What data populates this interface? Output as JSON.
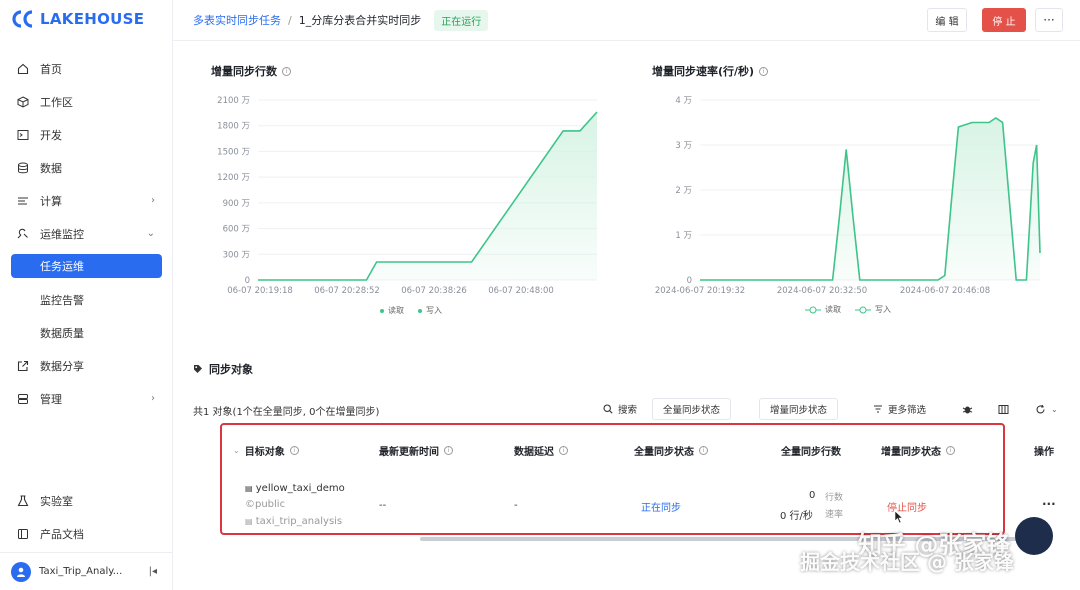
{
  "brand": {
    "name": "LAKEHOUSE"
  },
  "sidebar": {
    "items": [
      {
        "label": "首页",
        "icon": "home-icon"
      },
      {
        "label": "工作区",
        "icon": "cube-icon"
      },
      {
        "label": "开发",
        "icon": "terminal-icon"
      },
      {
        "label": "数据",
        "icon": "database-icon"
      },
      {
        "label": "计算",
        "icon": "compute-icon",
        "expandable": true
      },
      {
        "label": "运维监控",
        "icon": "monitor-icon",
        "expanded": true
      }
    ],
    "sub_items": [
      {
        "label": "任务运维",
        "active": true
      },
      {
        "label": "监控告警"
      },
      {
        "label": "数据质量"
      }
    ],
    "items2": [
      {
        "label": "数据分享",
        "icon": "share-icon"
      },
      {
        "label": "管理",
        "icon": "manage-icon",
        "expandable": true
      }
    ],
    "bottom": [
      {
        "label": "实验室",
        "icon": "flask-icon"
      },
      {
        "label": "产品文档",
        "icon": "book-icon"
      }
    ],
    "footer": {
      "workspace": "Taxi_Trip_Analy..."
    }
  },
  "header": {
    "breadcrumb_parent": "多表实时同步任务",
    "breadcrumb_sep": "/",
    "breadcrumb_current": "1_分库分表合并实时同步",
    "status": "正在运行",
    "edit_label": "编 辑",
    "stop_label": "停 止",
    "more_label": "···"
  },
  "charts": {
    "rows": {
      "title": "增量同步行数",
      "legend": [
        "读取",
        "写入"
      ]
    },
    "rate": {
      "title": "增量同步速率(行/秒)",
      "legend": [
        "读取",
        "写入"
      ]
    }
  },
  "chart_data": [
    {
      "type": "area",
      "title": "增量同步行数",
      "y_tick_labels": [
        "0",
        "300 万",
        "600 万",
        "900 万",
        "1200 万",
        "1500 万",
        "1800 万",
        "2100 万"
      ],
      "ylim": [
        0,
        2100
      ],
      "y_unit": "万",
      "x_tick_labels": [
        "06-07 20:19:18",
        "06-07 20:28:52",
        "06-07 20:38:26",
        "06-07 20:48:00"
      ],
      "x": [
        0,
        0.32,
        0.35,
        0.63,
        0.9,
        0.95,
        1.0
      ],
      "series": [
        {
          "name": "读取",
          "values": [
            0,
            0,
            210,
            210,
            1740,
            1740,
            1960
          ]
        },
        {
          "name": "写入",
          "values": [
            0,
            0,
            210,
            210,
            1740,
            1740,
            1960
          ]
        }
      ],
      "colors": {
        "line": "#3fc48a",
        "fill": "#d6f3e4"
      }
    },
    {
      "type": "area",
      "title": "增量同步速率(行/秒)",
      "y_tick_labels": [
        "0",
        "1 万",
        "2 万",
        "3 万",
        "4 万"
      ],
      "ylim": [
        0,
        4
      ],
      "y_unit": "万",
      "x_tick_labels": [
        "2024-06-07 20:19:32",
        "2024-06-07 20:32:50",
        "2024-06-07 20:46:08"
      ],
      "x": [
        0,
        0.39,
        0.41,
        0.43,
        0.45,
        0.47,
        0.7,
        0.72,
        0.74,
        0.76,
        0.8,
        0.85,
        0.87,
        0.89,
        0.93,
        0.96,
        0.98,
        0.99,
        1.0
      ],
      "series": [
        {
          "name": "读取",
          "values": [
            0,
            0,
            1.4,
            2.9,
            1.4,
            0,
            0,
            0.1,
            1.8,
            3.4,
            3.5,
            3.5,
            3.6,
            3.5,
            0,
            0,
            2.6,
            3.0,
            0.6
          ]
        },
        {
          "name": "写入",
          "values": [
            0,
            0,
            1.4,
            2.9,
            1.4,
            0,
            0,
            0.1,
            1.8,
            3.4,
            3.5,
            3.5,
            3.6,
            3.5,
            0,
            0,
            2.6,
            3.0,
            0.6
          ]
        }
      ],
      "colors": {
        "line": "#3fc48a",
        "fill": "#d6f3e4"
      }
    }
  ],
  "sync": {
    "title": "同步对象",
    "summary": "共1 对象(1个在全量同步, 0个在增量同步)",
    "toolbar": {
      "search": "搜索",
      "full_status": "全量同步状态",
      "incr_status": "增量同步状态",
      "more_filter": "更多筛选"
    },
    "columns": [
      "目标对象",
      "最新更新时间",
      "数据延迟",
      "全量同步状态",
      "全量同步行数",
      "增量同步状态",
      "操作"
    ],
    "row": {
      "table": "yellow_taxi_demo",
      "schema": "public",
      "workspace": "taxi_trip_analysis",
      "updated": "--",
      "delay": "-",
      "full_status": "正在同步",
      "rows_value": "0",
      "rows_unit": "行数",
      "rate_value": "0 行/秒",
      "rate_unit": "速率",
      "incr_status": "停止同步",
      "ops": "···"
    }
  },
  "watermark": {
    "line1": "知乎 @张家锋",
    "line2": "掘金技术社区 @ 张家锋"
  }
}
